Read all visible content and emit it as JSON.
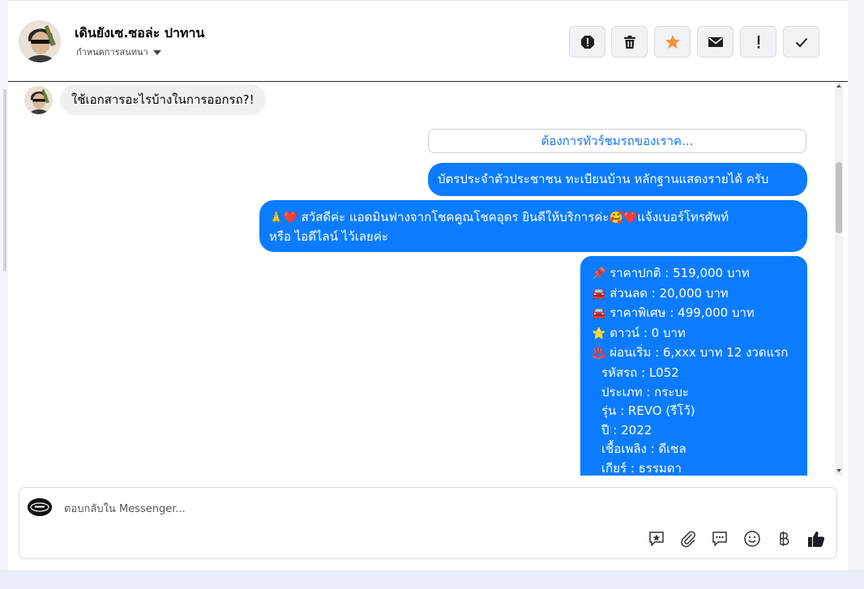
{
  "header": {
    "name": "เดินยังเซ.ซอล่ะ ปาทาน",
    "subtitle": "กำหนดการสนทนา",
    "actions": [
      {
        "name": "block-icon",
        "label": "Block"
      },
      {
        "name": "trash-icon",
        "label": "Delete"
      },
      {
        "name": "star-icon",
        "label": "Star"
      },
      {
        "name": "mail-icon",
        "label": "Mark as unread"
      },
      {
        "name": "exclamation-icon",
        "label": "Spam"
      },
      {
        "name": "check-icon",
        "label": "Done"
      }
    ]
  },
  "messages": {
    "incoming_1": "ใช้เอกสารอะไรบ้างในการออกรถ?!",
    "quick_reply": "ต้องการทัวร์ชมรถของเราค...",
    "outgoing_1": "บัตรประจำตัวประชาชน ทะเบียนบ้าน หลักฐานแสดงรายได้ ครับ",
    "outgoing_2": {
      "line1_emoji_pray": "🙏",
      "line1_emoji_heart": "❤️",
      "line1_text": " สวัสดีค่ะ แอดมินฟางจากโชคคูณโชคอุดร ยินดีให้บริการค่ะ",
      "line1_emoji_face": "🥰",
      "line1_emoji_heart2": "❤️",
      "line1_tail": "แจ้งเบอร์โทรศัพท์",
      "line2": "หรือ ไอดีไลน์  ไว้เลยค่ะ"
    },
    "outgoing_3": {
      "lines": [
        {
          "emoji": "📌",
          "text": " ราคาปกติ : 519,000 บาท"
        },
        {
          "emoji": "🚘",
          "text": " ส่วนลด : 20,000 บาท"
        },
        {
          "emoji": "🚘",
          "text": " ราคาพิเศษ : 499,000 บาท"
        },
        {
          "emoji": "⭐",
          "text": " ดาวน์ : 0 บาท"
        },
        {
          "emoji": "♨️",
          "text": " ผ่อนเริ่ม : 6,xxx บาท 12 งวดแรก"
        }
      ],
      "specs": [
        "รหัสรถ : L052",
        "ประเภท : กระบะ",
        "รุ่น : REVO (รีโว้)",
        "ปี : 2022",
        "เชื้อเพลิง : ดีเซล",
        "เกียร์ : ธรรมดา"
      ]
    }
  },
  "composer": {
    "placeholder": "ตอบกลับใน Messenger...",
    "tools": [
      "saved-reply-icon",
      "attachment-icon",
      "chat-icon",
      "emoji-icon",
      "baht-icon",
      "like-icon"
    ]
  },
  "colors": {
    "outgoing_bubble": "#0b7cff",
    "incoming_bubble": "#f0f0f0",
    "star": "#f7923a",
    "link": "#1877f2"
  }
}
